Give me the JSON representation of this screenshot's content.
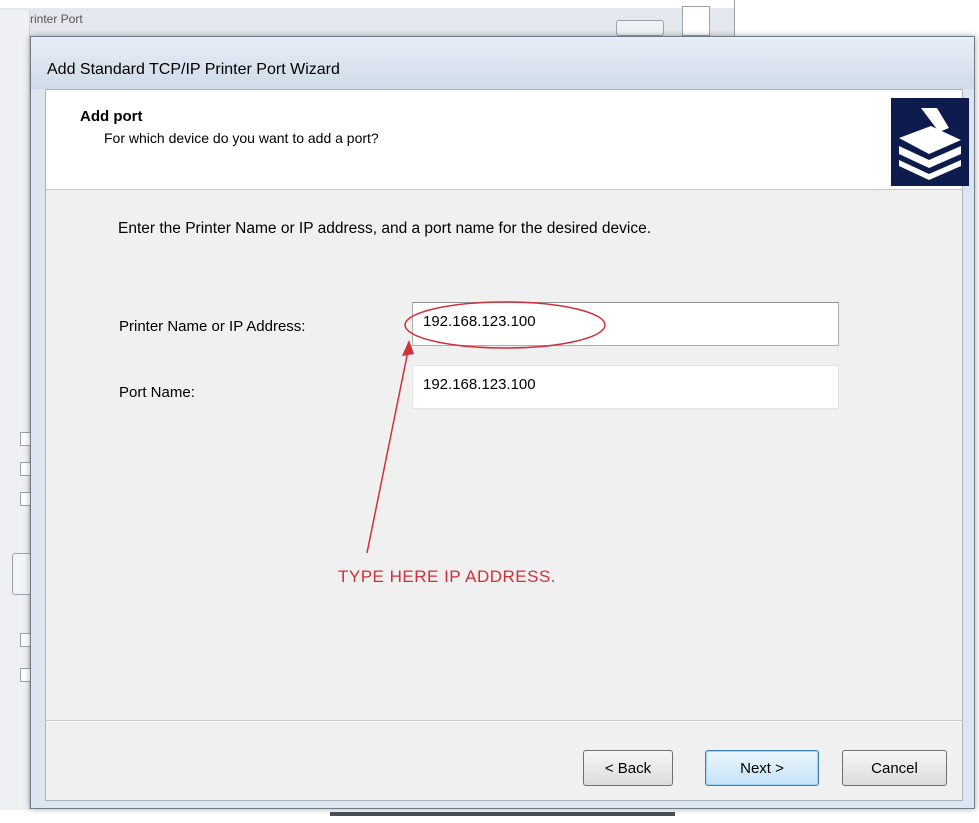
{
  "background": {
    "window_title_fragment": "Printer Port"
  },
  "dialog": {
    "title": "Add Standard TCP/IP Printer Port Wizard",
    "header": {
      "title": "Add port",
      "subtitle": "For which device do you want to add a port?",
      "icon": "printer-wizard-icon"
    },
    "instructions": "Enter the Printer Name or IP address, and a port name for the desired device.",
    "fields": {
      "printer_name_label": "Printer Name or IP Address:",
      "printer_name_value": "192.168.123.100",
      "port_name_label": "Port Name:",
      "port_name_value": "192.168.123.100"
    },
    "buttons": {
      "back": "< Back",
      "next": "Next >",
      "cancel": "Cancel"
    }
  },
  "annotation": {
    "text": "TYPE HERE IP ADDRESS.",
    "color": "#d0303a"
  }
}
